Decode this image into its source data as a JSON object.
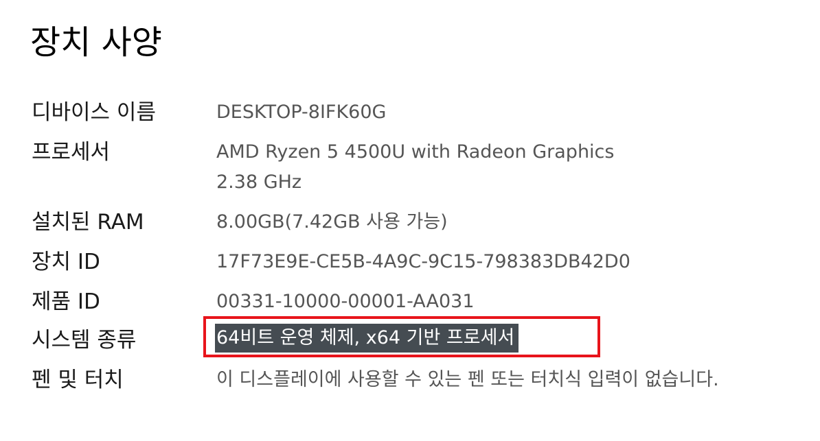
{
  "page": {
    "title": "장치 사양"
  },
  "specs": {
    "device_name": {
      "label": "디바이스 이름",
      "value": "DESKTOP-8IFK60G"
    },
    "processor": {
      "label": "프로세서",
      "value_line1": "AMD Ryzen 5 4500U with Radeon Graphics",
      "value_line2": "2.38 GHz"
    },
    "ram": {
      "label": "설치된 RAM",
      "value": "8.00GB(7.42GB 사용 가능)"
    },
    "device_id": {
      "label": "장치 ID",
      "value": "17F73E9E-CE5B-4A9C-9C15-798383DB42D0"
    },
    "product_id": {
      "label": "제품 ID",
      "value": "00331-10000-00001-AA031"
    },
    "system_type": {
      "label": "시스템 종류",
      "value": "64비트 운영 체제, x64 기반 프로세서"
    },
    "pen_touch": {
      "label": "펜 및 터치",
      "value": "이 디스플레이에 사용할 수 있는 펜 또는 터치식 입력이 없습니다."
    }
  },
  "colors": {
    "highlight_border": "#e8141b",
    "selection_background": "#454c52"
  }
}
